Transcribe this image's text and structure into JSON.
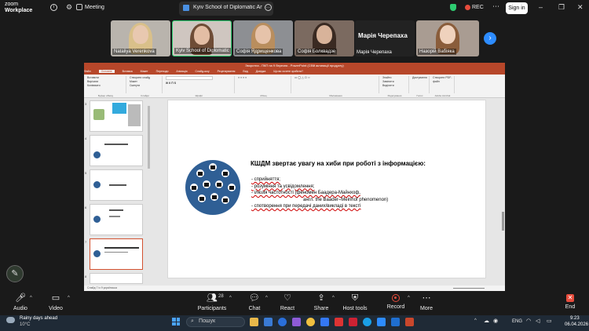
{
  "app": {
    "logo_line1": "zoom",
    "logo_line2": "Workplace",
    "meeting_label": "Meeting",
    "share_tab_label": "Kyiv School of Diplomatic Arts's s",
    "rec_label": "REC",
    "signin_label": "Sign in"
  },
  "participants": [
    {
      "name": "Nataliya Verenkova"
    },
    {
      "name": "Kyiv School of Diplomatic ..."
    },
    {
      "name": "Софія Ядрищенкова"
    },
    {
      "name": "Софія Болквадзе"
    },
    {
      "name": "Марія Черепаха",
      "big_name": "Марія Черепаха"
    },
    {
      "name": "Назорій Вабіяка"
    }
  ],
  "ppt": {
    "title_bar": "Зворотна - ПКП на 9 березня - PowerPoint (Сбій активації продукту)",
    "menu": [
      "Файл",
      "Основне",
      "Вставка",
      "Макет",
      "Переходи",
      "Анімація",
      "Слайд-шоу",
      "Рецензування",
      "Вид",
      "Довідка",
      "Що ви хочете зробити?"
    ],
    "active_menu": "Основне",
    "ribbon_groups": [
      "Буфер обміну",
      "Слайди",
      "Шрифт",
      "Абзац",
      "Малювання",
      "Редагування",
      "Голос",
      "Adobe Acrobat"
    ],
    "ribbon_items": {
      "paste": "Вставити",
      "cut": "Вирізати",
      "copy": "Копіювати",
      "format": "Формат за зразком",
      "new_slide": "Створити слайд",
      "layout": "Макет",
      "reset": "Скинути",
      "section": "Розділ",
      "find": "Знайти",
      "replace": "Замінити",
      "select": "Виділити",
      "dictate": "Диктування",
      "pdf": "Створити PDF-файл"
    },
    "status_left": "Слайд 7 із 9   українська",
    "slide_title": "КШДМ звертає увагу на хиби при роботі з інформацією:",
    "slide_items": [
      "- сприйняття;",
      "- розуміння та усвідомлення;",
      "- ілюзія частотності (феномен Баадера-Майнхоф,",
      "англ. the Baader–Meinhof phenomenon)",
      "- спотворення при передачі даних/викладі в тексті"
    ]
  },
  "toolbar": {
    "audio": "Audio",
    "video": "Video",
    "participants": "Participants",
    "participants_count": "28",
    "chat": "Chat",
    "react": "React",
    "share": "Share",
    "host_tools": "Host tools",
    "record": "Record",
    "more": "More",
    "end": "End"
  },
  "taskbar": {
    "weather_line1": "Rainy days ahead",
    "weather_line2": "10°C",
    "search_placeholder": "Пошук",
    "lang": "ENG",
    "time": "9:23",
    "date": "06.04.2026"
  },
  "colors": {
    "ppt_accent": "#b7472a",
    "zoom_blue": "#2d8cff",
    "record_red": "#e74c3c",
    "slide_circle": "#2f5f95"
  }
}
